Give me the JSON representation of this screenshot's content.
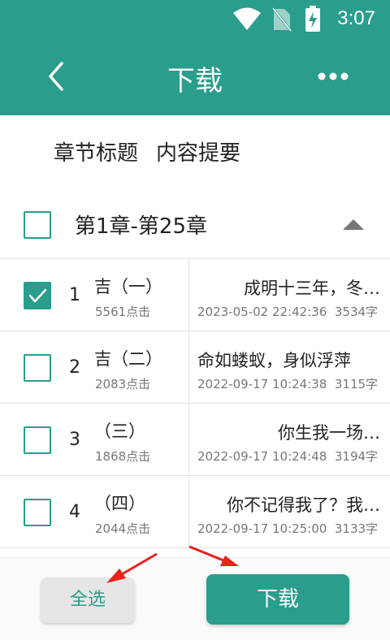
{
  "status_bar": {
    "time": "3:07",
    "icons": [
      "wifi-icon",
      "no-sim-icon",
      "battery-charging-icon"
    ]
  },
  "header": {
    "title": "下载",
    "back_icon": "chevron-left-icon",
    "more_icon": "more-horizontal-icon",
    "background": "#2a9d8c"
  },
  "tabs": [
    "章节标题",
    "内容提要"
  ],
  "group": {
    "title": "第1章-第25章",
    "checked": false,
    "collapse_icon": "triangle-up-icon"
  },
  "chapters": [
    {
      "num": "1",
      "name": "吉（一）",
      "clicks": "5561点击",
      "summary": "成明十三年，冬…",
      "date": "2023-05-02 22:42:36",
      "words": "3534字",
      "checked": true
    },
    {
      "num": "2",
      "name": "吉（二）",
      "clicks": "2083点击",
      "summary": "命如蝼蚁，身似浮萍",
      "date": "2022-09-17 10:24:38",
      "words": "3115字",
      "checked": false
    },
    {
      "num": "3",
      "name": "（三）",
      "clicks": "1868点击",
      "summary": "你生我一场…",
      "date": "2022-09-17 10:24:48",
      "words": "3194字",
      "checked": false
    },
    {
      "num": "4",
      "name": "（四）",
      "clicks": "2044点击",
      "summary": "你不记得我了？我…",
      "date": "2022-09-17 10:25:00",
      "words": "3133字",
      "checked": false
    }
  ],
  "footer": {
    "select_all_label": "全选",
    "download_label": "下载"
  },
  "accent_color": "#2a9d8c",
  "annotation_color": "#e8231a"
}
